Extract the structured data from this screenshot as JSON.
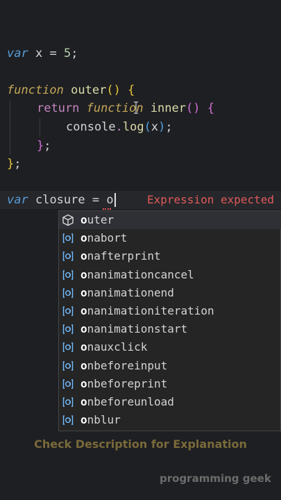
{
  "code": {
    "line1": {
      "kw": "var",
      "name": "x",
      "op": "=",
      "num": "5",
      "end": ";"
    },
    "line2": {
      "kw": "function",
      "name": "outer",
      "parens": "()",
      "brace": "{"
    },
    "line3": {
      "ret": "return",
      "kw": "function",
      "name": "inner",
      "parens": "()",
      "brace": "{"
    },
    "line4": {
      "obj": "console",
      "dot": ".",
      "method": "log",
      "open": "(",
      "arg": "x",
      "close": ")",
      "end": ";"
    },
    "line5": {
      "brace": "}",
      "end": ";"
    },
    "line6": {
      "brace": "}",
      "end": ";"
    },
    "line7": {
      "kw": "var",
      "name": "closure",
      "op": "=",
      "typed": "o"
    }
  },
  "error_message": "Expression expected",
  "suggestions": [
    {
      "icon": "cube-icon",
      "prefix": "o",
      "rest": "uter"
    },
    {
      "icon": "field-icon",
      "prefix": "o",
      "rest": "nabort"
    },
    {
      "icon": "field-icon",
      "prefix": "o",
      "rest": "nafterprint"
    },
    {
      "icon": "field-icon",
      "prefix": "o",
      "rest": "nanimationcancel"
    },
    {
      "icon": "field-icon",
      "prefix": "o",
      "rest": "nanimationend"
    },
    {
      "icon": "field-icon",
      "prefix": "o",
      "rest": "nanimationiteration"
    },
    {
      "icon": "field-icon",
      "prefix": "o",
      "rest": "nanimationstart"
    },
    {
      "icon": "field-icon",
      "prefix": "o",
      "rest": "nauxclick"
    },
    {
      "icon": "field-icon",
      "prefix": "o",
      "rest": "nbeforeinput"
    },
    {
      "icon": "field-icon",
      "prefix": "o",
      "rest": "nbeforeprint"
    },
    {
      "icon": "field-icon",
      "prefix": "o",
      "rest": "nbeforeunload"
    },
    {
      "icon": "field-icon",
      "prefix": "o",
      "rest": "nblur"
    }
  ],
  "caption": "Check Description for Explanation",
  "watermark": "programming geek",
  "colors": {
    "background": "#1e1f22",
    "error": "#e05a5a",
    "caption": "#7a6a3a"
  }
}
